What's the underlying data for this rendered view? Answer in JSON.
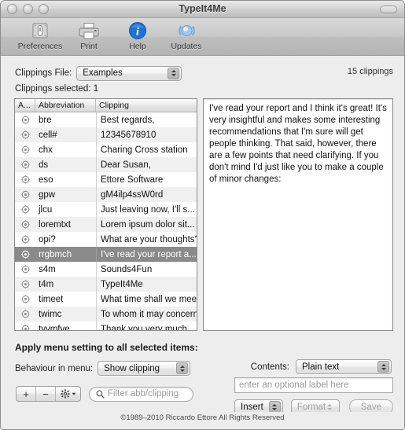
{
  "window": {
    "title": "TypeIt4Me",
    "traffic_lights": [
      "close",
      "minimize",
      "zoom"
    ]
  },
  "toolbar": {
    "items": [
      {
        "label": "Preferences",
        "icon": "preferences-switch-icon"
      },
      {
        "label": "Print",
        "icon": "printer-icon"
      },
      {
        "label": "Help",
        "icon": "info-circle-icon"
      },
      {
        "label": "Updates",
        "icon": "updates-refresh-icon"
      }
    ]
  },
  "clippings_file": {
    "label": "Clippings File:",
    "value": "Examples",
    "count_text": "15 clippings"
  },
  "selection": {
    "label": "Clippings selected: 1"
  },
  "table": {
    "headers": {
      "action": "A...",
      "abbreviation": "Abbreviation",
      "clipping": "Clipping"
    },
    "rows": [
      {
        "abbreviation": "bre",
        "clipping": "Best regards,",
        "selected": false
      },
      {
        "abbreviation": "cell#",
        "clipping": "12345678910",
        "selected": false
      },
      {
        "abbreviation": "chx",
        "clipping": "Charing Cross station",
        "selected": false
      },
      {
        "abbreviation": "ds",
        "clipping": "Dear Susan,",
        "selected": false
      },
      {
        "abbreviation": "eso",
        "clipping": "Ettore Software",
        "selected": false
      },
      {
        "abbreviation": "gpw",
        "clipping": "gM4ilp4ssW0rd",
        "selected": false
      },
      {
        "abbreviation": "jlcu",
        "clipping": "Just leaving now, I'll s...",
        "selected": false
      },
      {
        "abbreviation": "loremtxt",
        "clipping": "Lorem ipsum dolor sit...",
        "selected": false
      },
      {
        "abbreviation": "opi?",
        "clipping": "What are your thoughts?",
        "selected": false
      },
      {
        "abbreviation": "rrgbmch",
        "clipping": "I've read your report a...",
        "selected": true
      },
      {
        "abbreviation": "s4m",
        "clipping": "Sounds4Fun",
        "selected": false
      },
      {
        "abbreviation": "t4m",
        "clipping": "TypeIt4Me",
        "selected": false
      },
      {
        "abbreviation": "timeet",
        "clipping": "What time shall we meet?",
        "selected": false
      },
      {
        "abbreviation": "twimc",
        "clipping": "To whom it may concern,",
        "selected": false
      },
      {
        "abbreviation": "tyvmfye",
        "clipping": "Thank you very much ...",
        "selected": false
      }
    ]
  },
  "text_panel": {
    "content": "I've read your report and I think it's great! It's very insightful and makes some interesting recommendations that I'm sure will get people thinking. That said, however, there are a few points that need clarifying. If you don't mind I'd just like you to make a couple of minor changes:"
  },
  "apply_section": {
    "heading": "Apply menu setting to all selected items:",
    "behaviour_label": "Behaviour in menu:",
    "behaviour_value": "Show clipping"
  },
  "bottom_toolbar": {
    "add_label": "+",
    "remove_label": "−",
    "gear_icon": "gear-icon",
    "search_placeholder": "Filter abb/clipping",
    "search_icon": "search-icon"
  },
  "contents_section": {
    "label": "Contents:",
    "value": "Plain text",
    "optional_label_placeholder": "enter an optional label here",
    "insert_value": "Insert",
    "format_value": "Format",
    "save_label": "Save"
  },
  "footer": {
    "copyright": "©1989–2010 Riccardo Ettore All Rights Reserved"
  },
  "colors": {
    "window_bg": "#ededed",
    "selection": "#8a8a8a",
    "help_blue": "#1a6fd4",
    "disabled_text": "#a6a6a6"
  }
}
